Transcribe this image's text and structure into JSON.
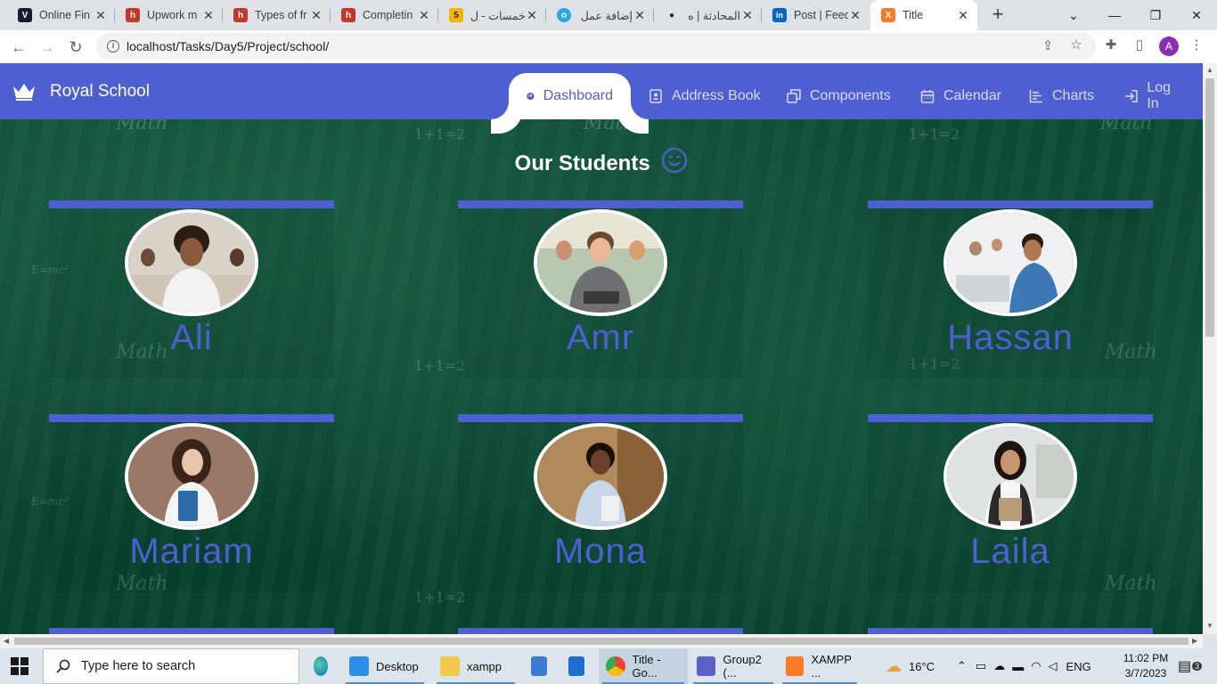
{
  "browser": {
    "tabs": [
      {
        "title": "Online Fin",
        "favicon_color": "#1a1a2e",
        "favicon_text": "V"
      },
      {
        "title": "Upwork m",
        "favicon_color": "#c0392b",
        "favicon_text": "h"
      },
      {
        "title": "Types of fr",
        "favicon_color": "#c0392b",
        "favicon_text": "h"
      },
      {
        "title": "Completin",
        "favicon_color": "#c0392b",
        "favicon_text": "h"
      },
      {
        "title": "خمسات - ل",
        "favicon_color": "#f4b400",
        "favicon_text": "5"
      },
      {
        "title": "إضافة عمل",
        "favicon_color": "#29a9e1",
        "favicon_text": "o"
      },
      {
        "title": "المحادثة | ه",
        "favicon_color": "#222222",
        "favicon_text": "●"
      },
      {
        "title": "Post | Feed",
        "favicon_color": "#0a66c2",
        "favicon_text": "in"
      },
      {
        "title": "Title",
        "favicon_color": "#fb7a24",
        "favicon_text": "X"
      }
    ],
    "url": "localhost/Tasks/Day5/Project/school/",
    "profile_initial": "A"
  },
  "navbar": {
    "brand": "Royal School",
    "items": [
      {
        "label": "Dashboard",
        "icon": "dashboard-icon"
      },
      {
        "label": "Address Book",
        "icon": "address-book-icon"
      },
      {
        "label": "Components",
        "icon": "components-icon"
      },
      {
        "label": "Calendar",
        "icon": "calendar-icon"
      },
      {
        "label": "Charts",
        "icon": "chart-icon"
      },
      {
        "label": "Log In",
        "icon": "login-icon"
      }
    ],
    "active_item": "Dashboard",
    "accent_color": "#4e5fd1"
  },
  "main": {
    "title": "Our Students",
    "students": [
      {
        "name": "Ali"
      },
      {
        "name": "Amr"
      },
      {
        "name": "Hassan"
      },
      {
        "name": "Mariam"
      },
      {
        "name": "Mona"
      },
      {
        "name": "Laila"
      }
    ]
  },
  "taskbar": {
    "search_placeholder": "Type here to search",
    "apps": [
      {
        "label": "Desktop"
      },
      {
        "label": "xampp"
      },
      {
        "label": "Title - Go..."
      },
      {
        "label": "Group2 (..."
      },
      {
        "label": "XAMPP ..."
      }
    ],
    "weather": "16°C",
    "language": "ENG",
    "time": "11:02 PM",
    "date": "3/7/2023",
    "notifications": "3"
  }
}
